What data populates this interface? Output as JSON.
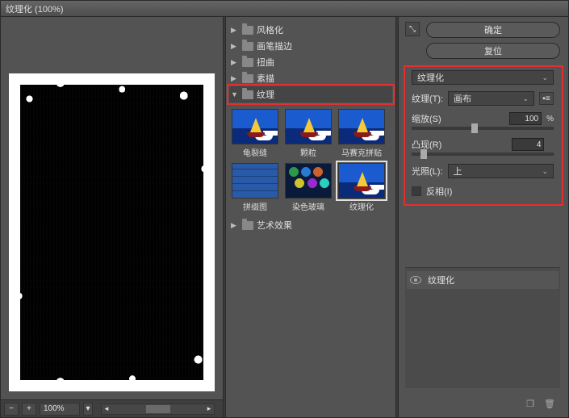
{
  "window": {
    "title": "纹理化 (100%)"
  },
  "preview": {
    "zoom": "100%"
  },
  "categories": [
    {
      "label": "风格化",
      "open": false
    },
    {
      "label": "画笔描边",
      "open": false
    },
    {
      "label": "扭曲",
      "open": false
    },
    {
      "label": "素描",
      "open": false
    },
    {
      "label": "纹理",
      "open": true
    },
    {
      "label": "艺术效果",
      "open": false
    }
  ],
  "thumbs": [
    {
      "label": "龟裂缝"
    },
    {
      "label": "颗粒"
    },
    {
      "label": "马赛克拼贴"
    },
    {
      "label": "拼缀图"
    },
    {
      "label": "染色玻璃"
    },
    {
      "label": "纹理化",
      "selected": true
    }
  ],
  "buttons": {
    "ok": "确定",
    "reset": "复位"
  },
  "filter_select": "纹理化",
  "params": {
    "texture_label": "纹理(T):",
    "texture_value": "画布",
    "scale_label": "缩放(S)",
    "scale_value": "100",
    "scale_pct": "%",
    "relief_label": "凸现(R)",
    "relief_value": "4",
    "light_label": "光照(L):",
    "light_value": "上",
    "invert_label": "反相(I)"
  },
  "layers": {
    "entry": "纹理化"
  }
}
